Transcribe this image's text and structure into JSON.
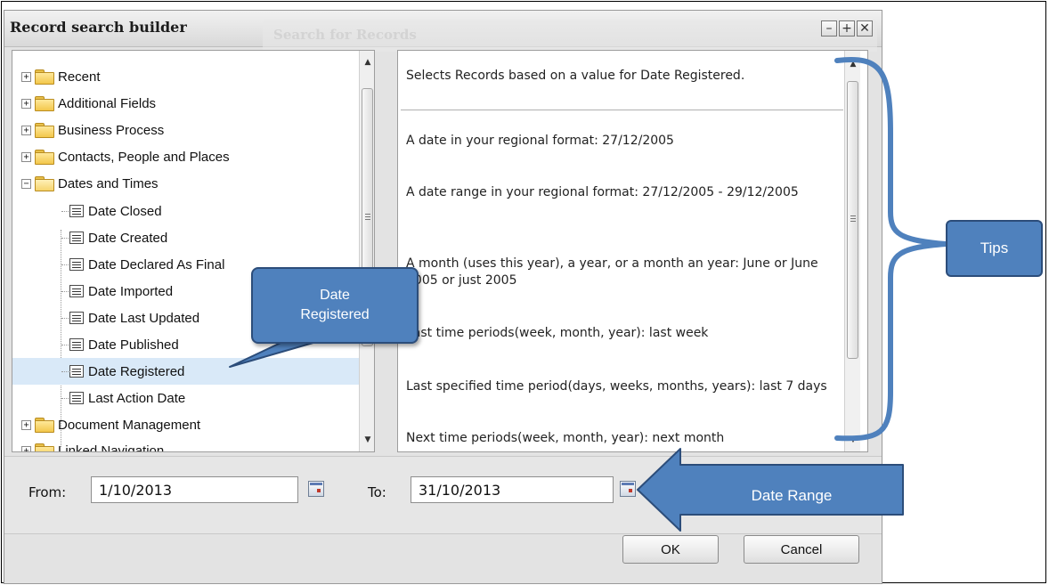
{
  "dialog": {
    "title": "Record search builder",
    "background_title": "Search for Records",
    "window_buttons": [
      "–",
      "+",
      "✕"
    ]
  },
  "tree": {
    "items": [
      {
        "label": "Recent",
        "type": "folder",
        "expanded": false
      },
      {
        "label": "Additional Fields",
        "type": "folder",
        "expanded": false
      },
      {
        "label": "Business Process",
        "type": "folder",
        "expanded": false
      },
      {
        "label": "Contacts, People and Places",
        "type": "folder",
        "expanded": false
      },
      {
        "label": "Dates and Times",
        "type": "folder",
        "expanded": true
      },
      {
        "label": "Date Closed",
        "type": "field"
      },
      {
        "label": "Date Created",
        "type": "field"
      },
      {
        "label": "Date Declared As Final",
        "type": "field"
      },
      {
        "label": "Date Imported",
        "type": "field"
      },
      {
        "label": "Date Last Updated",
        "type": "field"
      },
      {
        "label": "Date Published",
        "type": "field"
      },
      {
        "label": "Date Registered",
        "type": "field",
        "selected": true
      },
      {
        "label": "Last Action Date",
        "type": "field"
      },
      {
        "label": "Document Management",
        "type": "folder",
        "expanded": false
      },
      {
        "label": "Linked Navigation",
        "type": "folder",
        "expanded": false
      }
    ]
  },
  "tips": {
    "description": "Selects Records based on a value for Date Registered.",
    "items": [
      "A date in your regional format: 27/12/2005",
      "A date range in your regional format: 27/12/2005 - 29/12/2005",
      "A month (uses this year), a year, or a month an year: June or June 2005 or just 2005",
      "Last time periods(week, month, year): last week",
      "Last specified time period(days, weeks, months, years): last 7 days",
      "Next time periods(week, month, year): next month"
    ]
  },
  "date_range": {
    "from_label": "From:",
    "from_value": "1/10/2013",
    "to_label": "To:",
    "to_value": "31/10/2013"
  },
  "buttons": {
    "ok": "OK",
    "cancel": "Cancel"
  },
  "annotations": {
    "tips": "Tips",
    "date_registered": "Date Registered",
    "date_range": "Date Range",
    "color": "#4f81bd"
  }
}
